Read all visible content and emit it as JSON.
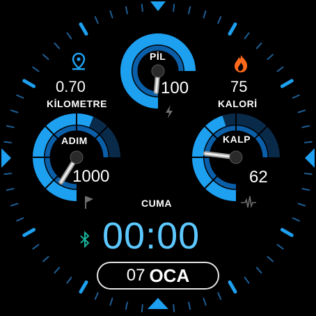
{
  "colors": {
    "accent": "#1ea0f0",
    "accent_dark": "#0b5fa8",
    "track": "#0a2a4a",
    "time": "#5cc8ff",
    "bluetooth": "#16b39a",
    "orange": "#ff6a1a",
    "white": "#ffffff",
    "bg": "#000000"
  },
  "distance": {
    "value": "0.70",
    "label": "KİLOMETRE",
    "icon": "location-pin-icon"
  },
  "calories": {
    "value": "75",
    "label": "KALORİ",
    "icon": "flame-icon"
  },
  "battery": {
    "label": "PİL",
    "value": "100",
    "level": 1.0,
    "icon": "lightning-icon"
  },
  "steps": {
    "label": "ADIM",
    "value": "1000",
    "progress": 0.75,
    "icon": "flag-icon"
  },
  "heart": {
    "label": "KALP",
    "value": "62",
    "progress": 0.6,
    "icon": "pulse-icon"
  },
  "weekday": "CUMA",
  "time": "00:00",
  "date": {
    "day": "07",
    "month": "OCA"
  },
  "bluetooth_icon": "bluetooth-icon"
}
